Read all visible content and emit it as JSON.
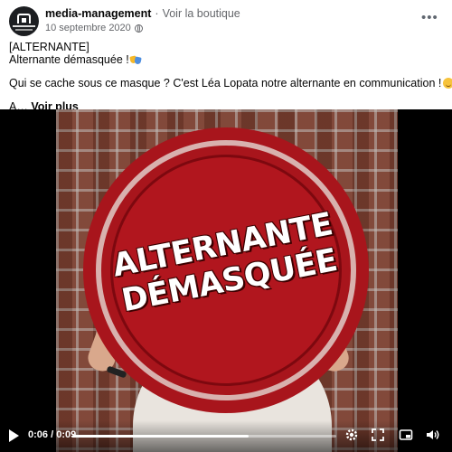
{
  "header": {
    "page_name": "media-management",
    "separator": "·",
    "shop_link": "Voir la boutique",
    "date": "10 septembre 2020",
    "more_label": "•••"
  },
  "post": {
    "line1": "[ALTERNANTE]",
    "line2": "Alternante démasquée !",
    "line3": "Qui se cache sous ce masque ? C'est Léa Lopata notre alternante en communication !",
    "truncation": "A…",
    "see_more": "Voir plus"
  },
  "video": {
    "stamp_line1": "ALTERNANTE",
    "stamp_line2": "DÉMASQUÉE",
    "current_time": "0:06",
    "duration": "0:09",
    "time_separator": "/",
    "progress_fraction": 0.667
  },
  "icons": {
    "play": "play-icon",
    "settings": "gear-icon",
    "fullscreen_alt": "expand-arrows-icon",
    "pip": "picture-in-picture-icon",
    "volume": "speaker-icon",
    "globe": "globe-icon"
  },
  "colors": {
    "stamp_red": "#a8151c",
    "secondary_text": "#65676b",
    "video_bg": "#000000"
  }
}
